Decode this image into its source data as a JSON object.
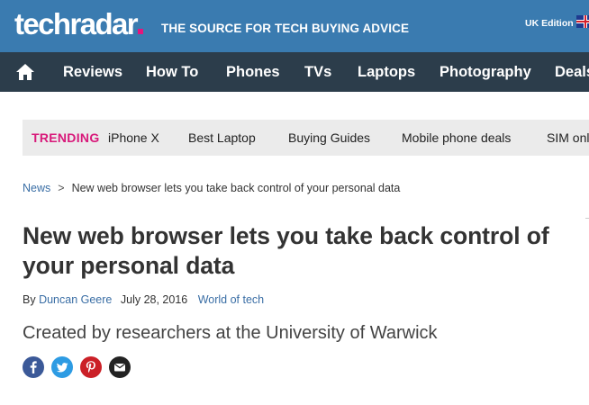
{
  "header": {
    "logo": "techradar",
    "tagline": "THE SOURCE FOR TECH BUYING ADVICE",
    "edition": "UK Edition",
    "colors": {
      "background": "#3a7bb0",
      "logo_dot": "#e4157c"
    }
  },
  "nav": {
    "home_icon": "home-icon",
    "items": [
      "Reviews",
      "How To",
      "Phones",
      "TVs",
      "Laptops",
      "Photography",
      "Deals"
    ],
    "colors": {
      "background": "#2c3d4b"
    }
  },
  "trending": {
    "label": "TRENDING",
    "items": [
      "iPhone X",
      "Best Laptop",
      "Buying Guides",
      "Mobile phone deals",
      "SIM only deals"
    ],
    "colors": {
      "label": "#d8197a",
      "background": "#ebebeb"
    }
  },
  "breadcrumb": {
    "parent": "News",
    "separator": ">",
    "current": "New web browser lets you take back control of your personal data"
  },
  "article": {
    "headline": "New web browser lets you take back control of your personal data",
    "byline_prefix": "By",
    "author": "Duncan Geere",
    "date": "July 28, 2016",
    "category": "World of tech",
    "subheadline": "Created by researchers at the University of Warwick"
  },
  "share": {
    "icons": [
      "facebook-icon",
      "twitter-icon",
      "pinterest-icon",
      "email-icon"
    ],
    "colors": {
      "facebook": "#3b5998",
      "twitter": "#2d9be3",
      "pinterest": "#cb2027",
      "email": "#222222"
    }
  }
}
